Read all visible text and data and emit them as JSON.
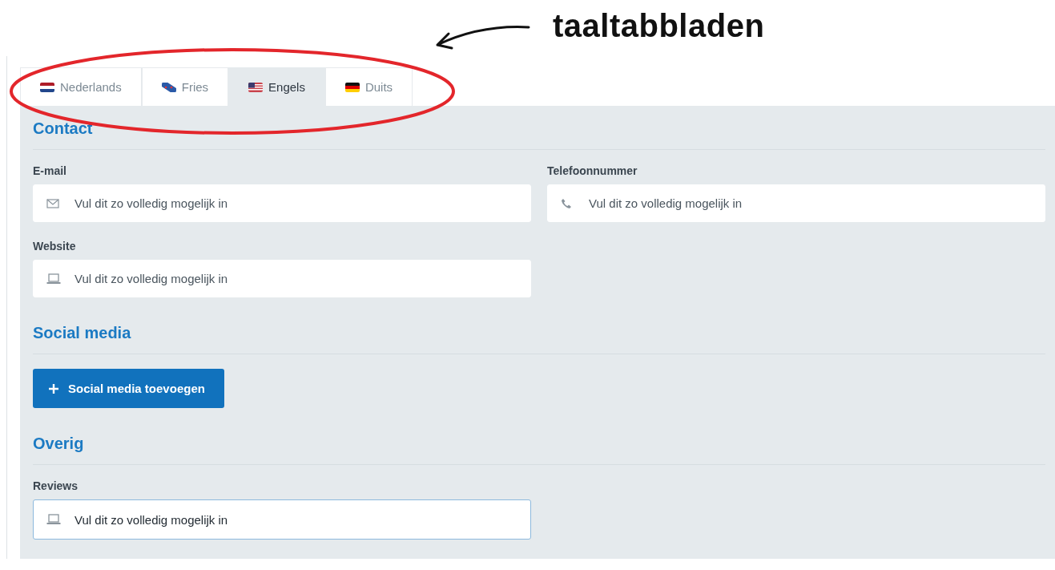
{
  "annotation": {
    "text": "taaltabbladen"
  },
  "tabs": [
    {
      "label": "Nederlands",
      "kind": "nl",
      "selected": false
    },
    {
      "label": "Fries",
      "kind": "fy",
      "selected": false
    },
    {
      "label": "Engels",
      "kind": "us",
      "selected": true
    },
    {
      "label": "Duits",
      "kind": "de",
      "selected": false
    }
  ],
  "sections": [
    {
      "title": "Contact",
      "fields": [
        {
          "label": "E-mail",
          "kind": "email",
          "placeholder": "Vul dit zo volledig mogelijk in",
          "focused": false
        },
        {
          "label": "Telefoonnummer",
          "kind": "phone",
          "placeholder": "Vul dit zo volledig mogelijk in",
          "focused": false
        },
        {
          "label": "Website",
          "kind": "url",
          "placeholder": "Vul dit zo volledig mogelijk in",
          "focused": false
        }
      ]
    },
    {
      "title": "Social media",
      "button": {
        "label": "Social media toevoegen"
      }
    },
    {
      "title": "Overig",
      "fields": [
        {
          "label": "Reviews",
          "kind": "url",
          "value": "Vul dit zo volledig mogelijk in",
          "focused": true
        }
      ]
    }
  ]
}
